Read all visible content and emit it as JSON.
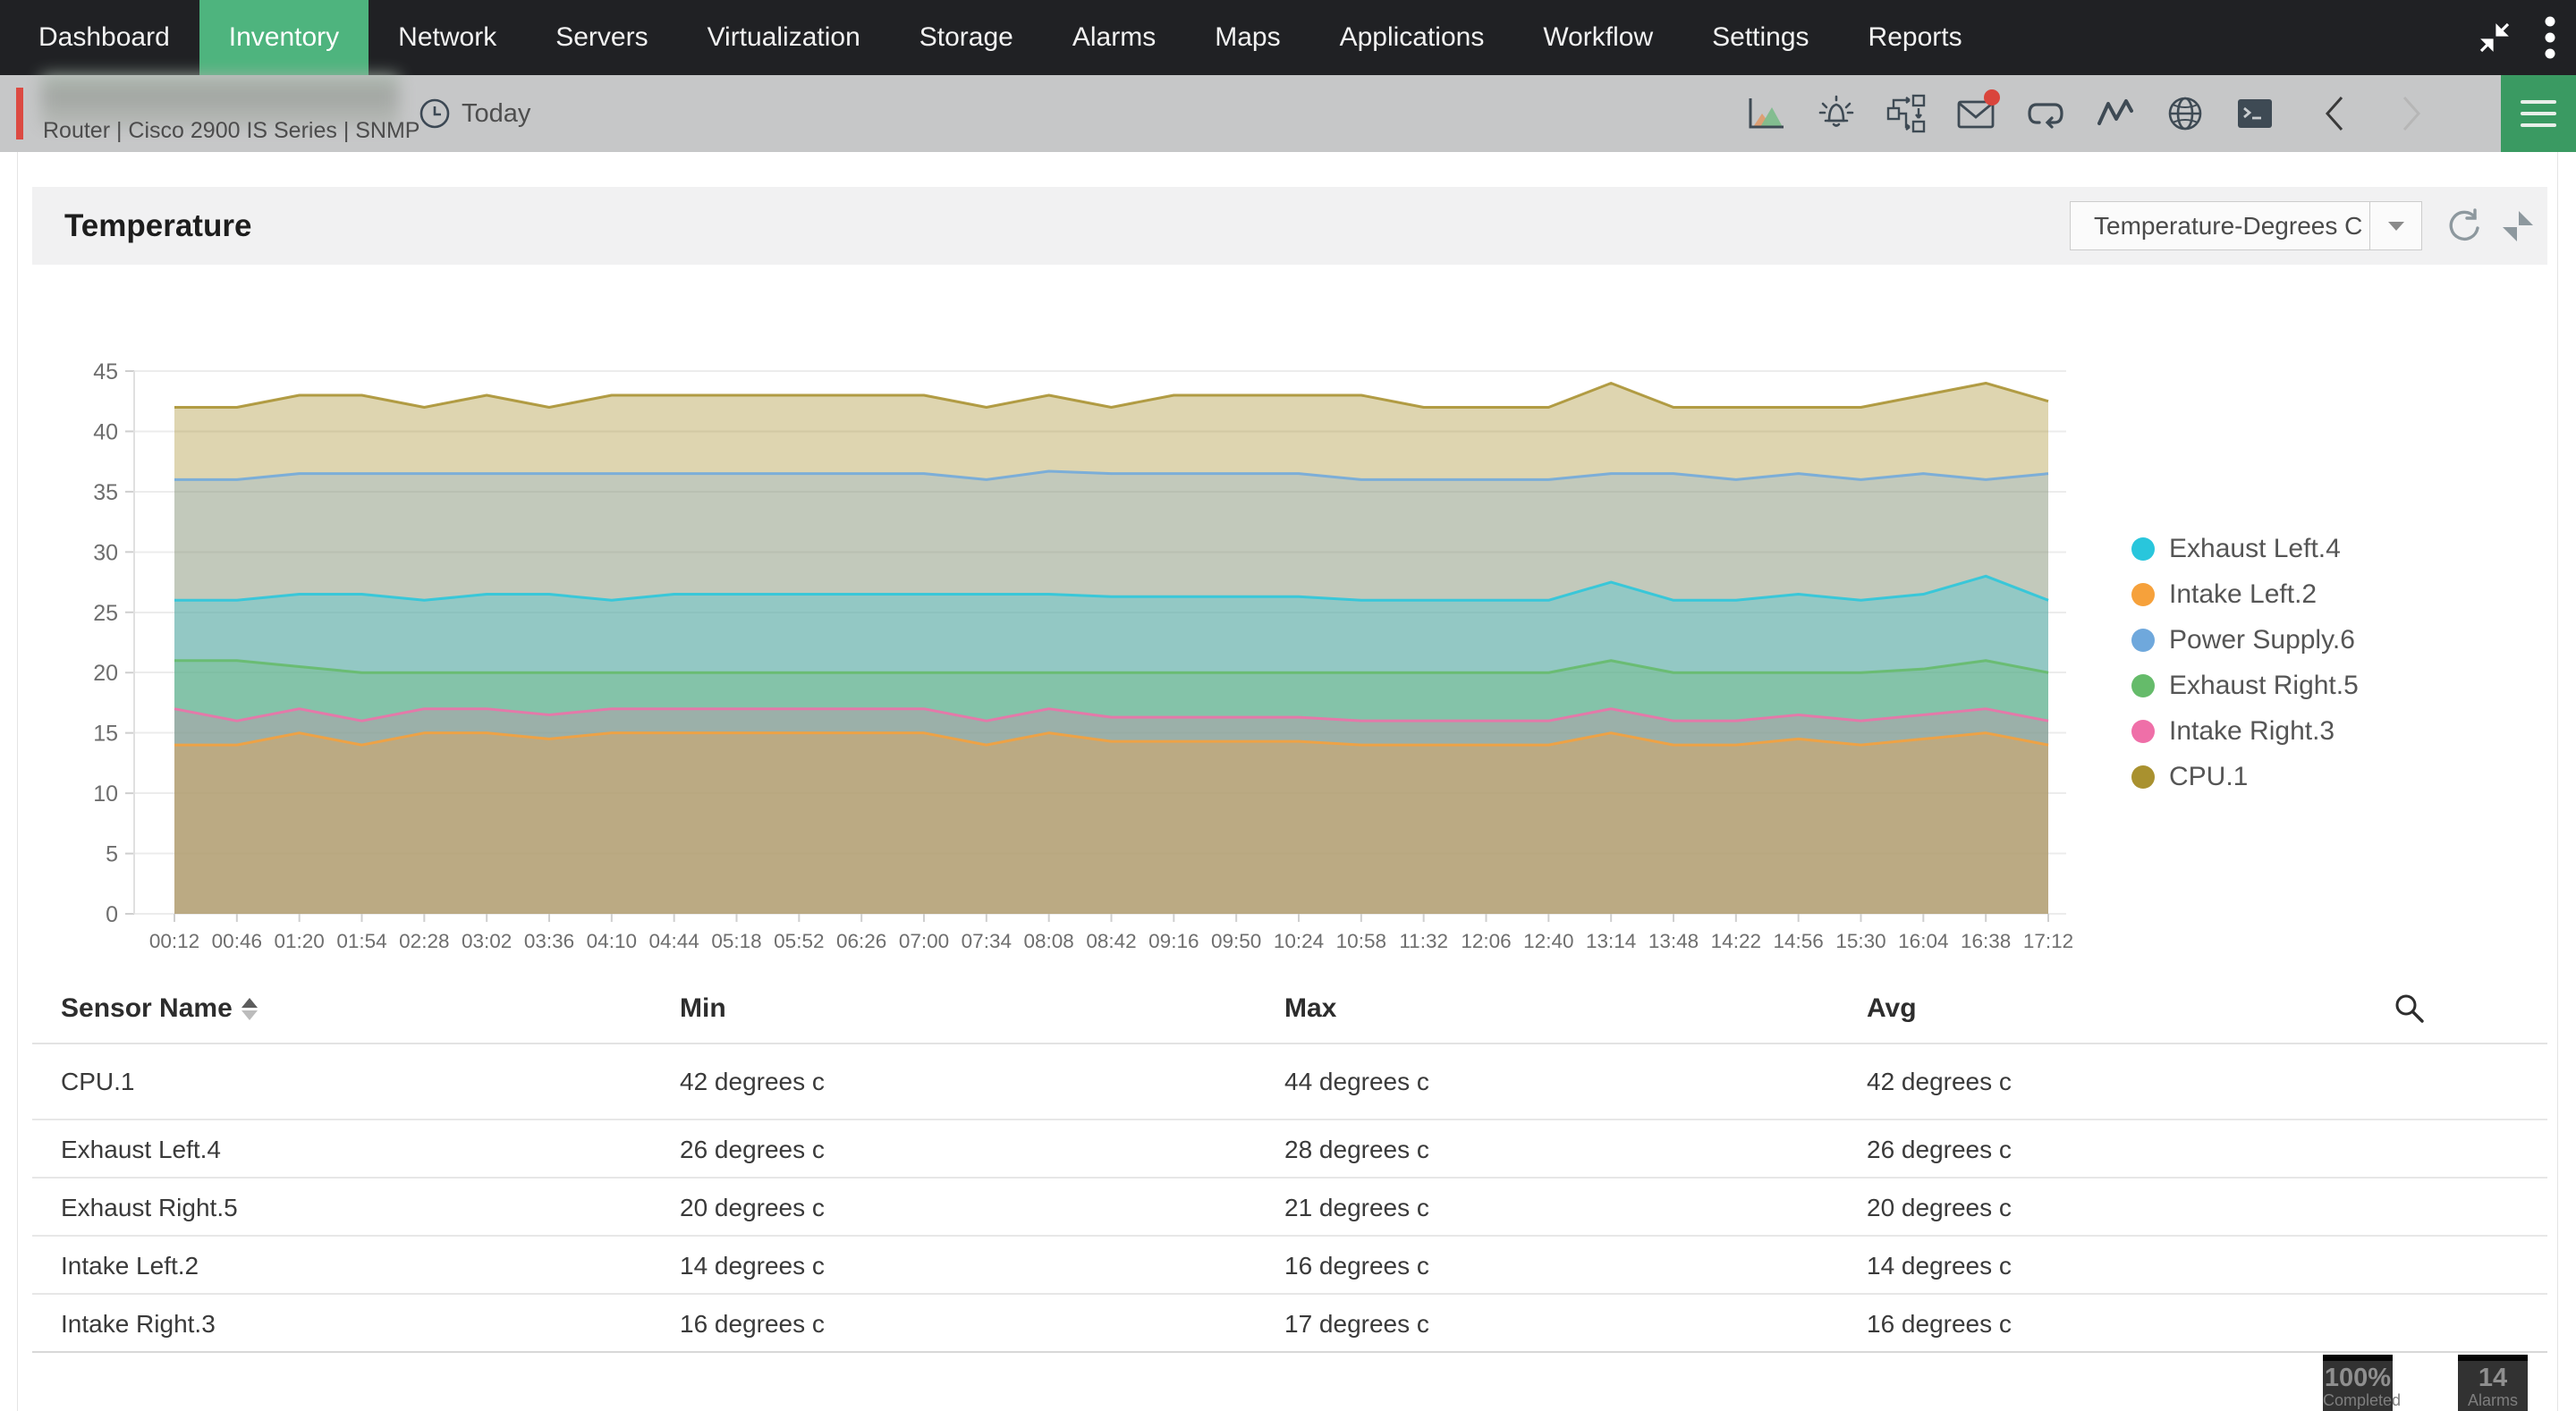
{
  "nav": {
    "items": [
      {
        "label": "Dashboard",
        "active": false
      },
      {
        "label": "Inventory",
        "active": true
      },
      {
        "label": "Network",
        "active": false
      },
      {
        "label": "Servers",
        "active": false
      },
      {
        "label": "Virtualization",
        "active": false
      },
      {
        "label": "Storage",
        "active": false
      },
      {
        "label": "Alarms",
        "active": false
      },
      {
        "label": "Maps",
        "active": false
      },
      {
        "label": "Applications",
        "active": false
      },
      {
        "label": "Workflow",
        "active": false
      },
      {
        "label": "Settings",
        "active": false
      },
      {
        "label": "Reports",
        "active": false
      }
    ],
    "active_color": "#4eb47e",
    "background": "#202124",
    "window_icons": [
      "collapse-icon",
      "kebab-menu-icon"
    ]
  },
  "device_bar": {
    "subtitle": "Router | Cisco 2900 IS Series  | SNMP",
    "time_filter": "Today",
    "accent_color": "#dc4a42",
    "background": "#c6c7c8",
    "icons": [
      "performance-graph-icon",
      "alarm-bell-icon",
      "workflow-icon",
      "mail-icon",
      "loop-icon",
      "monitor-zigzag-icon",
      "globe-icon",
      "terminal-icon",
      "chevron-left-icon",
      "chevron-right-icon",
      "hamburger-menu-icon"
    ]
  },
  "panel": {
    "title": "Temperature",
    "metric_dropdown_value": "Temperature-Degrees C",
    "action_icons": [
      "refresh-icon",
      "compare-icon"
    ]
  },
  "chart_data": {
    "type": "area",
    "title": "Temperature",
    "xlabel": "",
    "ylabel": "",
    "ylim": [
      0,
      45
    ],
    "ytick_step": 5,
    "grid": true,
    "legend_position": "right",
    "x": [
      "00:12",
      "00:46",
      "01:20",
      "01:54",
      "02:28",
      "03:02",
      "03:36",
      "04:10",
      "04:44",
      "05:18",
      "05:52",
      "06:26",
      "07:00",
      "07:34",
      "08:08",
      "08:42",
      "09:16",
      "09:50",
      "10:24",
      "10:58",
      "11:32",
      "12:06",
      "12:40",
      "13:14",
      "13:48",
      "14:22",
      "14:56",
      "15:30",
      "16:04",
      "16:38",
      "17:12"
    ],
    "series": [
      {
        "name": "Exhaust Left.4",
        "color": "#29c6dc",
        "fill_opacity": 0.3,
        "values": [
          26,
          26,
          26.5,
          26.5,
          26,
          26.5,
          26.5,
          26,
          26.5,
          26.5,
          26.5,
          26.5,
          26.5,
          26.5,
          26.5,
          26.3,
          26.3,
          26.3,
          26.3,
          26,
          26,
          26,
          26,
          27.5,
          26,
          26,
          26.5,
          26,
          26.5,
          28,
          26
        ]
      },
      {
        "name": "Intake Left.2",
        "color": "#f6a13b",
        "fill_opacity": 0.35,
        "values": [
          14,
          14,
          15,
          14,
          15,
          15,
          14.5,
          15,
          15,
          15,
          15,
          15,
          15,
          14,
          15,
          14.3,
          14.3,
          14.3,
          14.3,
          14,
          14,
          14,
          14,
          15,
          14,
          14,
          14.5,
          14,
          14.5,
          15,
          14
        ]
      },
      {
        "name": "Power Supply.6",
        "color": "#6fa8dc",
        "fill_opacity": 0.25,
        "values": [
          36,
          36,
          36.5,
          36.5,
          36.5,
          36.5,
          36.5,
          36.5,
          36.5,
          36.5,
          36.5,
          36.5,
          36.5,
          36,
          36.7,
          36.5,
          36.5,
          36.5,
          36.5,
          36,
          36,
          36,
          36,
          36.5,
          36.5,
          36,
          36.5,
          36,
          36.5,
          36,
          36.5
        ]
      },
      {
        "name": "Exhaust Right.5",
        "color": "#65bb6a",
        "fill_opacity": 0.3,
        "values": [
          21,
          21,
          20.5,
          20,
          20,
          20,
          20,
          20,
          20,
          20,
          20,
          20,
          20,
          20,
          20,
          20,
          20,
          20,
          20,
          20,
          20,
          20,
          20,
          21,
          20,
          20,
          20,
          20,
          20.3,
          21,
          20
        ]
      },
      {
        "name": "Intake Right.3",
        "color": "#ef6fa8",
        "fill_opacity": 0.22,
        "values": [
          17,
          16,
          17,
          16,
          17,
          17,
          16.5,
          17,
          17,
          17,
          17,
          17,
          17,
          16,
          17,
          16.3,
          16.3,
          16.3,
          16.3,
          16,
          16,
          16,
          16,
          17,
          16,
          16,
          16.5,
          16,
          16.5,
          17,
          16
        ]
      },
      {
        "name": "CPU.1",
        "color": "#a9912f",
        "fill_opacity": 0.38,
        "values": [
          42,
          42,
          43,
          43,
          42,
          43,
          42,
          43,
          43,
          43,
          43,
          43,
          43,
          42,
          43,
          42,
          43,
          43,
          43,
          43,
          42,
          42,
          42,
          44,
          42,
          42,
          42,
          42,
          43,
          44,
          42.5
        ]
      }
    ],
    "draw_order": [
      "CPU.1",
      "Power Supply.6",
      "Exhaust Left.4",
      "Exhaust Right.5",
      "Intake Right.3",
      "Intake Left.2"
    ]
  },
  "table": {
    "columns": [
      "Sensor Name",
      "Min",
      "Max",
      "Avg"
    ],
    "sort_column": "Sensor Name",
    "sort_direction": "asc",
    "rows": [
      {
        "sensor": "CPU.1",
        "min": "42 degrees c",
        "max": "44 degrees c",
        "avg": "42 degrees c"
      },
      {
        "sensor": "Exhaust Left.4",
        "min": "26 degrees c",
        "max": "28 degrees c",
        "avg": "26 degrees c"
      },
      {
        "sensor": "Exhaust Right.5",
        "min": "20 degrees c",
        "max": "21 degrees c",
        "avg": "20 degrees c"
      },
      {
        "sensor": "Intake Left.2",
        "min": "14 degrees c",
        "max": "16 degrees c",
        "avg": "14 degrees c"
      },
      {
        "sensor": "Intake Right.3",
        "min": "16 degrees c",
        "max": "17 degrees c",
        "avg": "16 degrees c"
      }
    ]
  },
  "footer": {
    "badges": [
      {
        "value": "100%",
        "label": "Completed"
      },
      {
        "value": "14",
        "label": "Alarms"
      }
    ]
  }
}
